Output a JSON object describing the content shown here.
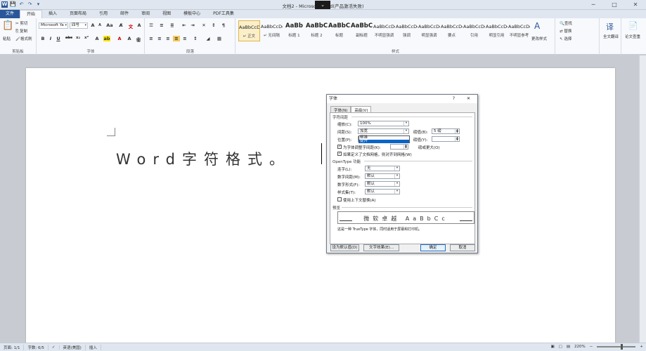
{
  "window": {
    "title": "文档2 - Microsoft Word(产品激活失败)",
    "minimize": "─",
    "maximize": "□",
    "close": "✕"
  },
  "qat": {
    "word_icon": "W",
    "save_icon": "💾",
    "undo_icon": "↶",
    "redo_icon": "↷",
    "more_icon": "▾"
  },
  "tabs": [
    "文件",
    "开始",
    "插入",
    "页面布局",
    "引用",
    "邮件",
    "审阅",
    "视图",
    "模板中心",
    "PDF工具集"
  ],
  "ribbon": {
    "clipboard": {
      "label": "剪贴板",
      "paste": "粘贴",
      "cut": "剪切",
      "copy": "复制",
      "format_painter": "格式刷"
    },
    "font": {
      "label": "字体",
      "font_name": "Microsoft Ya",
      "font_size": "四号",
      "bold": "B",
      "italic": "I",
      "underline": "U",
      "strike": "abc",
      "sub": "x₂",
      "sup": "x²",
      "grow": "A",
      "shrink": "A",
      "change_case": "Aa",
      "font_color": "A"
    },
    "paragraph": {
      "label": "段落"
    },
    "styles": {
      "label": "样式",
      "items": [
        {
          "sample": "AaBbCcDd",
          "name": "↵ 正文"
        },
        {
          "sample": "AaBbCcDd",
          "name": "↵ 无间隔"
        },
        {
          "sample": "AaBb",
          "name": "标题 1"
        },
        {
          "sample": "AaBbC",
          "name": "标题 2"
        },
        {
          "sample": "AaBbC",
          "name": "标题"
        },
        {
          "sample": "AaBbC",
          "name": "副标题"
        },
        {
          "sample": "AaBbCcDd",
          "name": "不明显强调"
        },
        {
          "sample": "AaBbCcDd",
          "name": "强调"
        },
        {
          "sample": "AaBbCcDd",
          "name": "明显强调"
        },
        {
          "sample": "AaBbCcDd",
          "name": "要点"
        },
        {
          "sample": "AaBbCcDd",
          "name": "引用"
        },
        {
          "sample": "AaBbCcDd",
          "name": "明显引用"
        },
        {
          "sample": "AaBbCcDd",
          "name": "不明显参考"
        }
      ],
      "change_styles": "更改样式"
    },
    "editing": {
      "find": "查找",
      "replace": "替换",
      "select": "选择"
    },
    "translate": "全文翻译",
    "check": "论文查重"
  },
  "document": {
    "text": "Word字符格式。"
  },
  "status": {
    "page": "页面: 1/1",
    "words": "字数: 6/5",
    "language": "英语(美国)",
    "mode": "插入",
    "zoom": "220%"
  },
  "dialog": {
    "title": "字体",
    "help": "?",
    "close": "✕",
    "tabs": [
      "字体(N)",
      "高级(V)"
    ],
    "spacing_section": "字符间距",
    "scale_label": "缩放(C):",
    "scale_value": "100%",
    "spacing_label": "间距(S):",
    "spacing_value": "加宽",
    "spacing_by_label": "磅值(B):",
    "spacing_by_value": "5 磅",
    "position_label": "位置(P):",
    "position_value": "标准",
    "position_by_label": "磅值(Y):",
    "position_by_value": "",
    "dropdown_options": [
      "标准",
      "提升"
    ],
    "kerning_label": "为字体调整字间距(K):",
    "kerning_tail": "磅或更大(O)",
    "grid_label": "如果定义了文档网格，则对齐到网格(W)",
    "opentype_section": "OpenType 功能",
    "ligatures_label": "连字(L):",
    "ligatures_value": "无",
    "num_spacing_label": "数字间距(M):",
    "num_spacing_value": "默认",
    "num_forms_label": "数字形式(F):",
    "num_forms_value": "默认",
    "stylistic_label": "样式集(T):",
    "stylistic_value": "默认",
    "contextual_label": "使用上下文替换(A)",
    "preview_section": "预览",
    "preview_text": "微软卓越 AaBbCc",
    "note": "这是一种 TrueType 字体，同时适用于屏幕和打印机。",
    "btn_default": "设为默认值(D)",
    "btn_effects": "文字效果(E)...",
    "btn_ok": "确定",
    "btn_cancel": "取消"
  }
}
